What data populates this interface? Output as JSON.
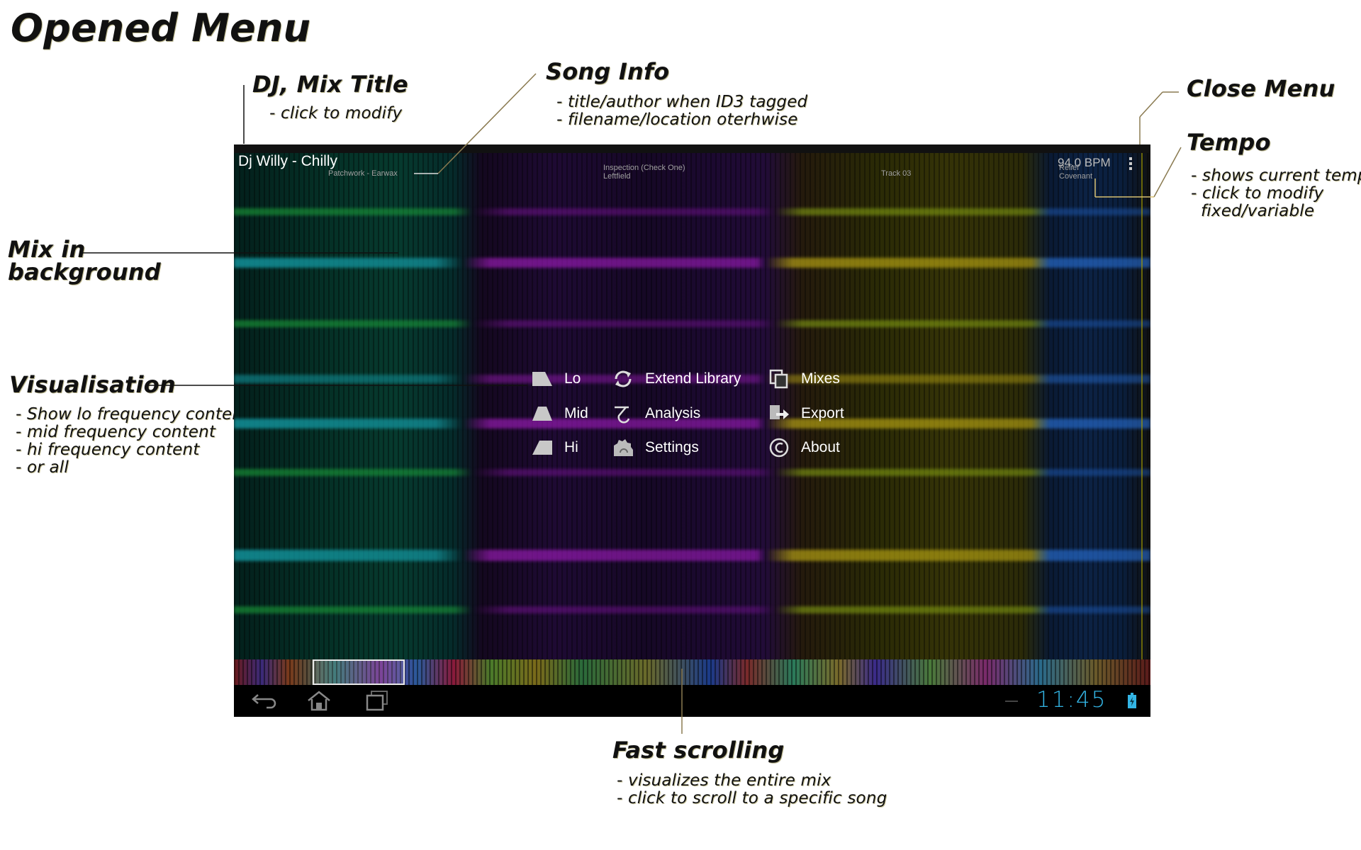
{
  "page_title": "Opened Menu",
  "annotations": {
    "dj_mix_title": {
      "heading": "DJ, Mix Title",
      "notes": [
        "- click to modify"
      ]
    },
    "song_info": {
      "heading": "Song Info",
      "notes": [
        "- title/author when ID3 tagged",
        "- filename/location oterhwise"
      ]
    },
    "close_menu": {
      "heading": "Close Menu"
    },
    "tempo": {
      "heading": "Tempo",
      "notes": [
        "- shows current tempo",
        "- click to modify",
        "fixed/variable"
      ]
    },
    "mix_background": {
      "heading_line1": "Mix in",
      "heading_line2": "background"
    },
    "visualisation": {
      "heading": "Visualisation",
      "notes": [
        "- Show lo frequency content",
        "- mid frequency content",
        "- hi frequency content",
        "- or all"
      ]
    },
    "fast_scrolling": {
      "heading": "Fast scrolling",
      "notes": [
        "- visualizes the entire mix",
        "- click to scroll to a specific song"
      ]
    }
  },
  "app": {
    "mix_title": "Dj Willy - Chilly",
    "songs": [
      {
        "title": "Patchwork - Earwax",
        "artist": ""
      },
      {
        "title": "Inspection (Check One)",
        "artist": "Leftfield"
      },
      {
        "title": "Track 03",
        "artist": ""
      },
      {
        "title": "Relief",
        "artist": "Covenant"
      }
    ],
    "tempo": "94.0 BPM",
    "overflow_icon": "overflow-menu-icon",
    "menu": {
      "visualisation": [
        {
          "label": "Lo",
          "icon": "lo-frequency-icon"
        },
        {
          "label": "Mid",
          "icon": "mid-frequency-icon"
        },
        {
          "label": "Hi",
          "icon": "hi-frequency-icon"
        }
      ],
      "actions": [
        {
          "label": "Extend Library",
          "icon": "refresh-icon"
        },
        {
          "label": "Analysis",
          "icon": "analysis-icon"
        },
        {
          "label": "Settings",
          "icon": "settings-icon"
        }
      ],
      "other": [
        {
          "label": "Mixes",
          "icon": "copy-icon"
        },
        {
          "label": "Export",
          "icon": "export-icon"
        },
        {
          "label": "About",
          "icon": "copyright-icon"
        }
      ]
    },
    "navbar": {
      "back_icon": "back-icon",
      "home_icon": "home-icon",
      "recents_icon": "recent-apps-icon",
      "clock": "11:45",
      "battery_icon": "battery-icon",
      "clock_color": "#33b5e5"
    }
  }
}
